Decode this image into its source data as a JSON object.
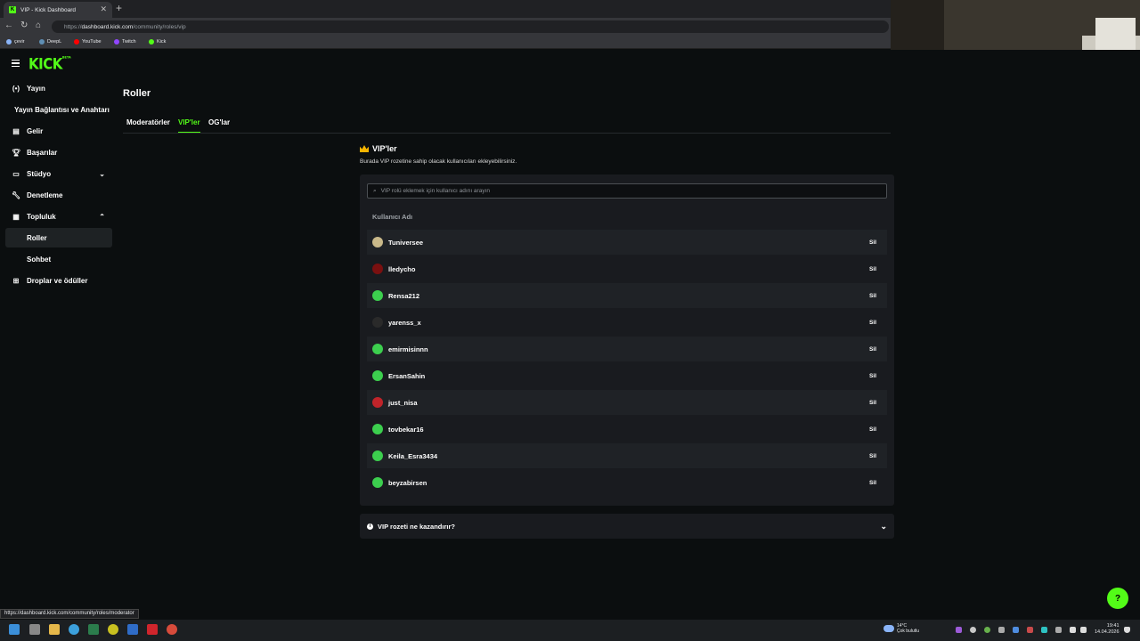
{
  "browser": {
    "tab_title": "VIP - Kick Dashboard",
    "url_prefix": "https://",
    "url_domain": "dashboard.kick.com",
    "url_path": "/community/roles/vip",
    "bookmarks": [
      {
        "label": "çevir",
        "color": "#8ab4f8"
      },
      {
        "label": "DeepL",
        "color": "#0f2b46"
      },
      {
        "label": "YouTube",
        "color": "#ff0000"
      },
      {
        "label": "Twitch",
        "color": "#9146ff"
      },
      {
        "label": "Kick",
        "color": "#53fc18"
      }
    ],
    "status_url": "https://dashboard.kick.com/community/roles/moderator"
  },
  "brand": {
    "logo": "KICK",
    "logo_badge": "BETA",
    "accent": "#53fc18"
  },
  "sidebar": {
    "items": [
      {
        "label": "Yayın",
        "icon": "broadcast-icon"
      },
      {
        "label": "Yayın Bağlantısı ve Anahtarı",
        "icon": ""
      },
      {
        "label": "Gelir",
        "icon": "revenue-icon"
      },
      {
        "label": "Başarılar",
        "icon": "trophy-icon"
      },
      {
        "label": "Stüdyo",
        "icon": "studio-icon"
      },
      {
        "label": "Denetleme",
        "icon": "wrench-icon"
      },
      {
        "label": "Topluluk",
        "icon": "community-icon"
      },
      {
        "label": "Roller",
        "icon": ""
      },
      {
        "label": "Sohbet",
        "icon": ""
      },
      {
        "label": "Droplar ve ödüller",
        "icon": "drops-icon"
      }
    ]
  },
  "page": {
    "title": "Roller",
    "tabs": [
      {
        "label": "Moderatörler"
      },
      {
        "label": "VIP'ler"
      },
      {
        "label": "OG'lar"
      }
    ]
  },
  "vip": {
    "heading": "VIP'ler",
    "description": "Burada VIP rozetine sahip olacak kullanıcıları ekleyebilirsiniz.",
    "search_placeholder": "VIP rolü eklemek için kullanıcı adını arayın",
    "column_header": "Kullanıcı Adı",
    "delete_label": "Sil",
    "users": [
      {
        "name": "Tuniversee",
        "avatar_color": "#c9b98a"
      },
      {
        "name": "lledycho",
        "avatar_color": "#7a1010"
      },
      {
        "name": "Rensa212",
        "avatar_color": "#3ccf4e"
      },
      {
        "name": "yarenss_x",
        "avatar_color": "#2a2a2a"
      },
      {
        "name": "emirmisinnn",
        "avatar_color": "#3ccf4e"
      },
      {
        "name": "ErsanSahin",
        "avatar_color": "#3ccf4e"
      },
      {
        "name": "just_nisa",
        "avatar_color": "#c0242a"
      },
      {
        "name": "tovbekar16",
        "avatar_color": "#3ccf4e"
      },
      {
        "name": "Keila_Esra3434",
        "avatar_color": "#3ccf4e"
      },
      {
        "name": "beyzabirsen",
        "avatar_color": "#3ccf4e"
      }
    ]
  },
  "faq": {
    "question": "VIP rozeti ne kazandırır?"
  },
  "taskbar": {
    "temperature": "14°C",
    "weather": "Çok bulutlu",
    "time": "19:41",
    "date": "14.04.2026"
  }
}
